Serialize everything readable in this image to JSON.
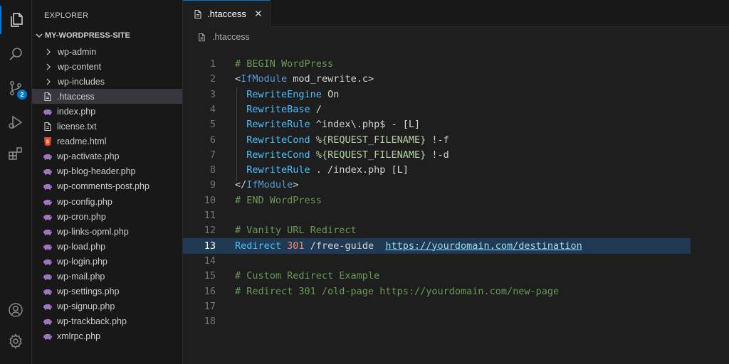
{
  "explorer": {
    "title": "EXPLORER",
    "folder": "MY-WORDPRESS-SITE",
    "items": [
      {
        "label": "wp-admin",
        "type": "folder"
      },
      {
        "label": "wp-content",
        "type": "folder"
      },
      {
        "label": "wp-includes",
        "type": "folder"
      },
      {
        "label": ".htaccess",
        "type": "file",
        "icon": "file-icon",
        "selected": true
      },
      {
        "label": "index.php",
        "type": "file",
        "icon": "php-icon"
      },
      {
        "label": "license.txt",
        "type": "file",
        "icon": "file-icon"
      },
      {
        "label": "readme.html",
        "type": "file",
        "icon": "html5-icon"
      },
      {
        "label": "wp-activate.php",
        "type": "file",
        "icon": "php-icon"
      },
      {
        "label": "wp-blog-header.php",
        "type": "file",
        "icon": "php-icon"
      },
      {
        "label": "wp-comments-post.php",
        "type": "file",
        "icon": "php-icon"
      },
      {
        "label": "wp-config.php",
        "type": "file",
        "icon": "php-icon"
      },
      {
        "label": "wp-cron.php",
        "type": "file",
        "icon": "php-icon"
      },
      {
        "label": "wp-links-opml.php",
        "type": "file",
        "icon": "php-icon"
      },
      {
        "label": "wp-load.php",
        "type": "file",
        "icon": "php-icon"
      },
      {
        "label": "wp-login.php",
        "type": "file",
        "icon": "php-icon"
      },
      {
        "label": "wp-mail.php",
        "type": "file",
        "icon": "php-icon"
      },
      {
        "label": "wp-settings.php",
        "type": "file",
        "icon": "php-icon"
      },
      {
        "label": "wp-signup.php",
        "type": "file",
        "icon": "php-icon"
      },
      {
        "label": "wp-trackback.php",
        "type": "file",
        "icon": "php-icon"
      },
      {
        "label": "xmlrpc.php",
        "type": "file",
        "icon": "php-icon"
      }
    ]
  },
  "activity": {
    "source_control_badge": "2"
  },
  "tab": {
    "label": ".htaccess",
    "close": "✕"
  },
  "breadcrumb": {
    "label": ".htaccess"
  },
  "editor": {
    "current_line": 13,
    "lines": [
      {
        "n": "1",
        "tokens": [
          {
            "t": "# BEGIN WordPress",
            "c": "c-com"
          }
        ]
      },
      {
        "n": "2",
        "tokens": [
          {
            "t": "<",
            "c": "c-txt"
          },
          {
            "t": "IfModule",
            "c": "c-tag"
          },
          {
            "t": " mod_rewrite.c>",
            "c": "c-txt"
          }
        ]
      },
      {
        "n": "3",
        "tokens": [
          {
            "t": "  ",
            "c": "c-txt"
          },
          {
            "t": "RewriteEngine",
            "c": "c-dir"
          },
          {
            "t": " On",
            "c": "c-txt"
          }
        ]
      },
      {
        "n": "4",
        "tokens": [
          {
            "t": "  ",
            "c": "c-txt"
          },
          {
            "t": "RewriteBase",
            "c": "c-dir"
          },
          {
            "t": " /",
            "c": "c-txt"
          }
        ]
      },
      {
        "n": "5",
        "tokens": [
          {
            "t": "  ",
            "c": "c-txt"
          },
          {
            "t": "RewriteRule",
            "c": "c-dir"
          },
          {
            "t": " ^index\\.php$ - [L]",
            "c": "c-txt"
          }
        ]
      },
      {
        "n": "6",
        "tokens": [
          {
            "t": "  ",
            "c": "c-txt"
          },
          {
            "t": "RewriteCond",
            "c": "c-dir"
          },
          {
            "t": " ",
            "c": "c-txt"
          },
          {
            "t": "%{REQUEST_FILENAME}",
            "c": "c-var"
          },
          {
            "t": " !-f",
            "c": "c-txt"
          }
        ]
      },
      {
        "n": "7",
        "tokens": [
          {
            "t": "  ",
            "c": "c-txt"
          },
          {
            "t": "RewriteCond",
            "c": "c-dir"
          },
          {
            "t": " ",
            "c": "c-txt"
          },
          {
            "t": "%{REQUEST_FILENAME}",
            "c": "c-var"
          },
          {
            "t": " !-d",
            "c": "c-txt"
          }
        ]
      },
      {
        "n": "8",
        "tokens": [
          {
            "t": "  ",
            "c": "c-txt"
          },
          {
            "t": "RewriteRule",
            "c": "c-dir"
          },
          {
            "t": " . /index.php [L]",
            "c": "c-txt"
          }
        ]
      },
      {
        "n": "9",
        "tokens": [
          {
            "t": "</",
            "c": "c-txt"
          },
          {
            "t": "IfModule",
            "c": "c-tag"
          },
          {
            "t": ">",
            "c": "c-txt"
          }
        ]
      },
      {
        "n": "10",
        "tokens": [
          {
            "t": "# END WordPress",
            "c": "c-com"
          }
        ]
      },
      {
        "n": "11",
        "tokens": []
      },
      {
        "n": "12",
        "tokens": [
          {
            "t": "# Vanity URL Redirect",
            "c": "c-com"
          }
        ]
      },
      {
        "n": "13",
        "tokens": [
          {
            "t": "Redirect",
            "c": "c-dir"
          },
          {
            "t": " ",
            "c": "c-txt"
          },
          {
            "t": "301",
            "c": "c-num"
          },
          {
            "t": " /free-guide  ",
            "c": "c-txt"
          },
          {
            "t": "https://yourdomain.com/destination",
            "c": "c-url"
          }
        ]
      },
      {
        "n": "14",
        "tokens": []
      },
      {
        "n": "15",
        "tokens": [
          {
            "t": "# Custom Redirect Example",
            "c": "c-com"
          }
        ]
      },
      {
        "n": "16",
        "tokens": [
          {
            "t": "# Redirect 301 /old-page https://yourdomain.com/new-page",
            "c": "c-com"
          }
        ]
      },
      {
        "n": "17",
        "tokens": []
      },
      {
        "n": "18",
        "tokens": []
      }
    ]
  }
}
